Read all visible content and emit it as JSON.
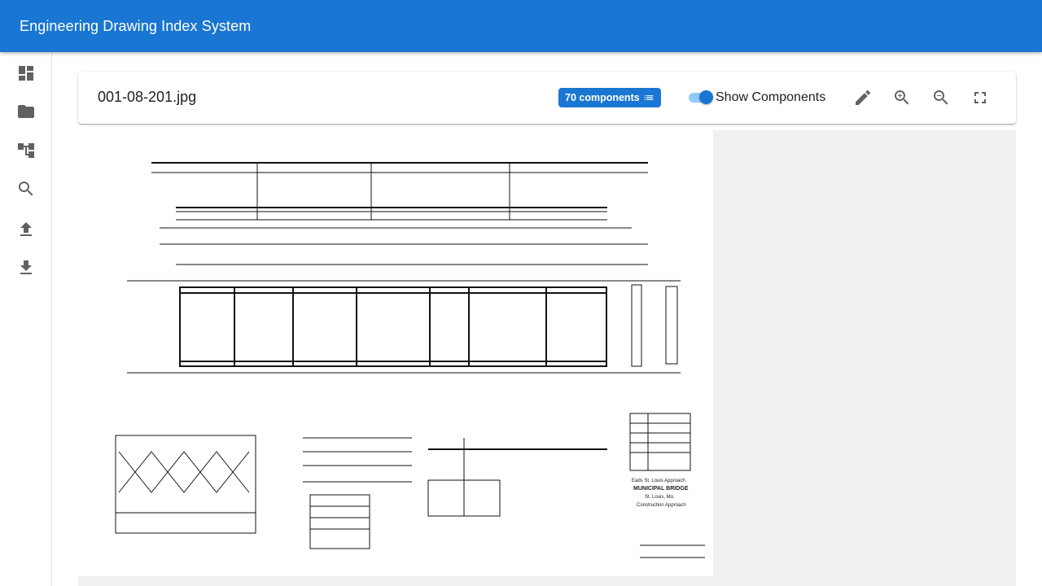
{
  "app": {
    "title": "Engineering Drawing Index System"
  },
  "sidebar": {
    "items": [
      {
        "name": "dashboard",
        "icon": "dashboard-icon"
      },
      {
        "name": "folder",
        "icon": "folder-icon"
      },
      {
        "name": "hierarchy",
        "icon": "account-tree-icon"
      },
      {
        "name": "search",
        "icon": "search-icon"
      },
      {
        "name": "upload",
        "icon": "upload-icon"
      },
      {
        "name": "download",
        "icon": "download-icon"
      }
    ]
  },
  "header": {
    "filename": "001-08-201.jpg",
    "components_chip": "70 components",
    "toggle_label": "Show Components",
    "toggle_on": true
  },
  "toolbar": {
    "icons": [
      "edit-icon",
      "zoom-in-icon",
      "zoom-out-icon",
      "fullscreen-icon"
    ]
  },
  "drawing": {
    "title_block": [
      "Eads St. Louis Approach",
      "MUNICIPAL BRIDGE",
      "St. Louis, Mo.",
      "Construction Approach"
    ]
  },
  "colors": {
    "primary": "#1976d2",
    "toggle_track": "#90caf9",
    "viewer_bg": "#f0f0f0"
  }
}
